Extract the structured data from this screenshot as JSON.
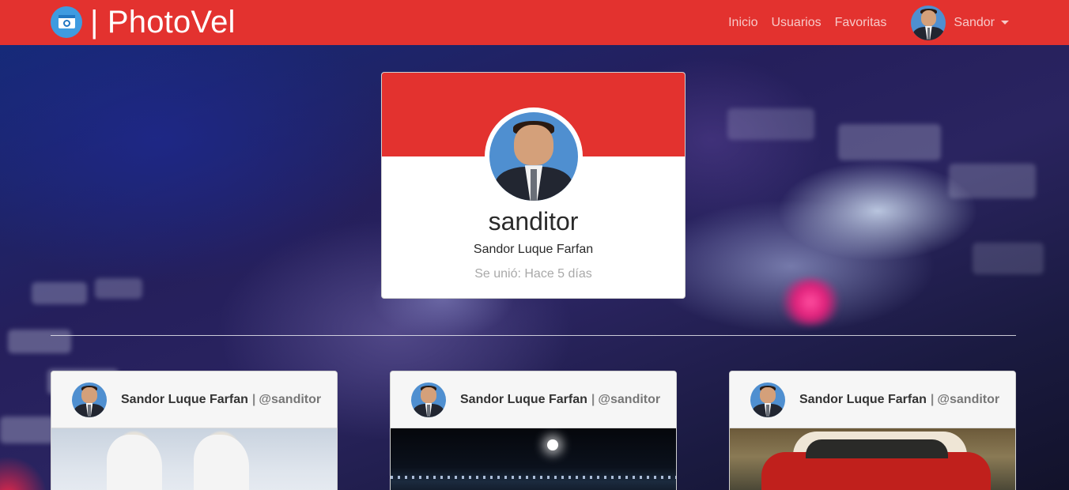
{
  "navbar": {
    "brand_text": "| PhotoVel",
    "links": [
      "Inicio",
      "Usuarios",
      "Favoritas"
    ],
    "user_name": "Sandor",
    "accent_color": "#e3322f"
  },
  "profile": {
    "username": "sanditor",
    "full_name": "Sandor Luque Farfan",
    "joined": "Se unió: Hace 5 días"
  },
  "posts": [
    {
      "author": "Sandor Luque Farfan",
      "separator": "|",
      "handle": "@sanditor",
      "image": "white-horses"
    },
    {
      "author": "Sandor Luque Farfan",
      "separator": "|",
      "handle": "@sanditor",
      "image": "night-lights"
    },
    {
      "author": "Sandor Luque Farfan",
      "separator": "|",
      "handle": "@sanditor",
      "image": "red-classic-car"
    }
  ],
  "icons": {
    "brand": "camera-icon",
    "dropdown": "caret-down-icon"
  }
}
